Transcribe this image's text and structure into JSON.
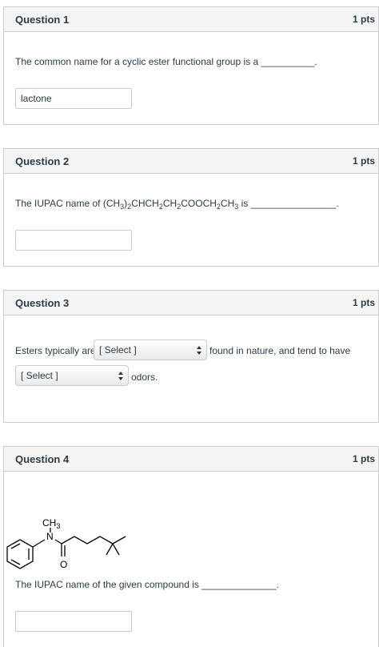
{
  "q1": {
    "title": "Question 1",
    "points": "1 pts",
    "text": "The common name for a cyclic ester functional group is a __________.",
    "answer": "lactone"
  },
  "q2": {
    "title": "Question 2",
    "points": "1 pts",
    "text_before": "The IUPAC name of (CH",
    "formula_parts": [
      "3",
      ")",
      "2",
      "CHCH",
      "2",
      "CH",
      "2",
      "COOCH",
      "2",
      "CH",
      "3"
    ],
    "text_after": " is ________________.",
    "answer": ""
  },
  "q3": {
    "title": "Question 3",
    "points": "1 pts",
    "text1": "Esters typically are",
    "select1": "[ Select ]",
    "text2": "found in nature, and tend to have",
    "select2": "[ Select ]",
    "text3": "odors."
  },
  "q4": {
    "title": "Question 4",
    "points": "1 pts",
    "structure_labels": {
      "methyl": "CH3",
      "nitrogen": "N",
      "oxygen": "O"
    },
    "text": "The IUPAC name of the given compound is ______________.",
    "answer": ""
  }
}
